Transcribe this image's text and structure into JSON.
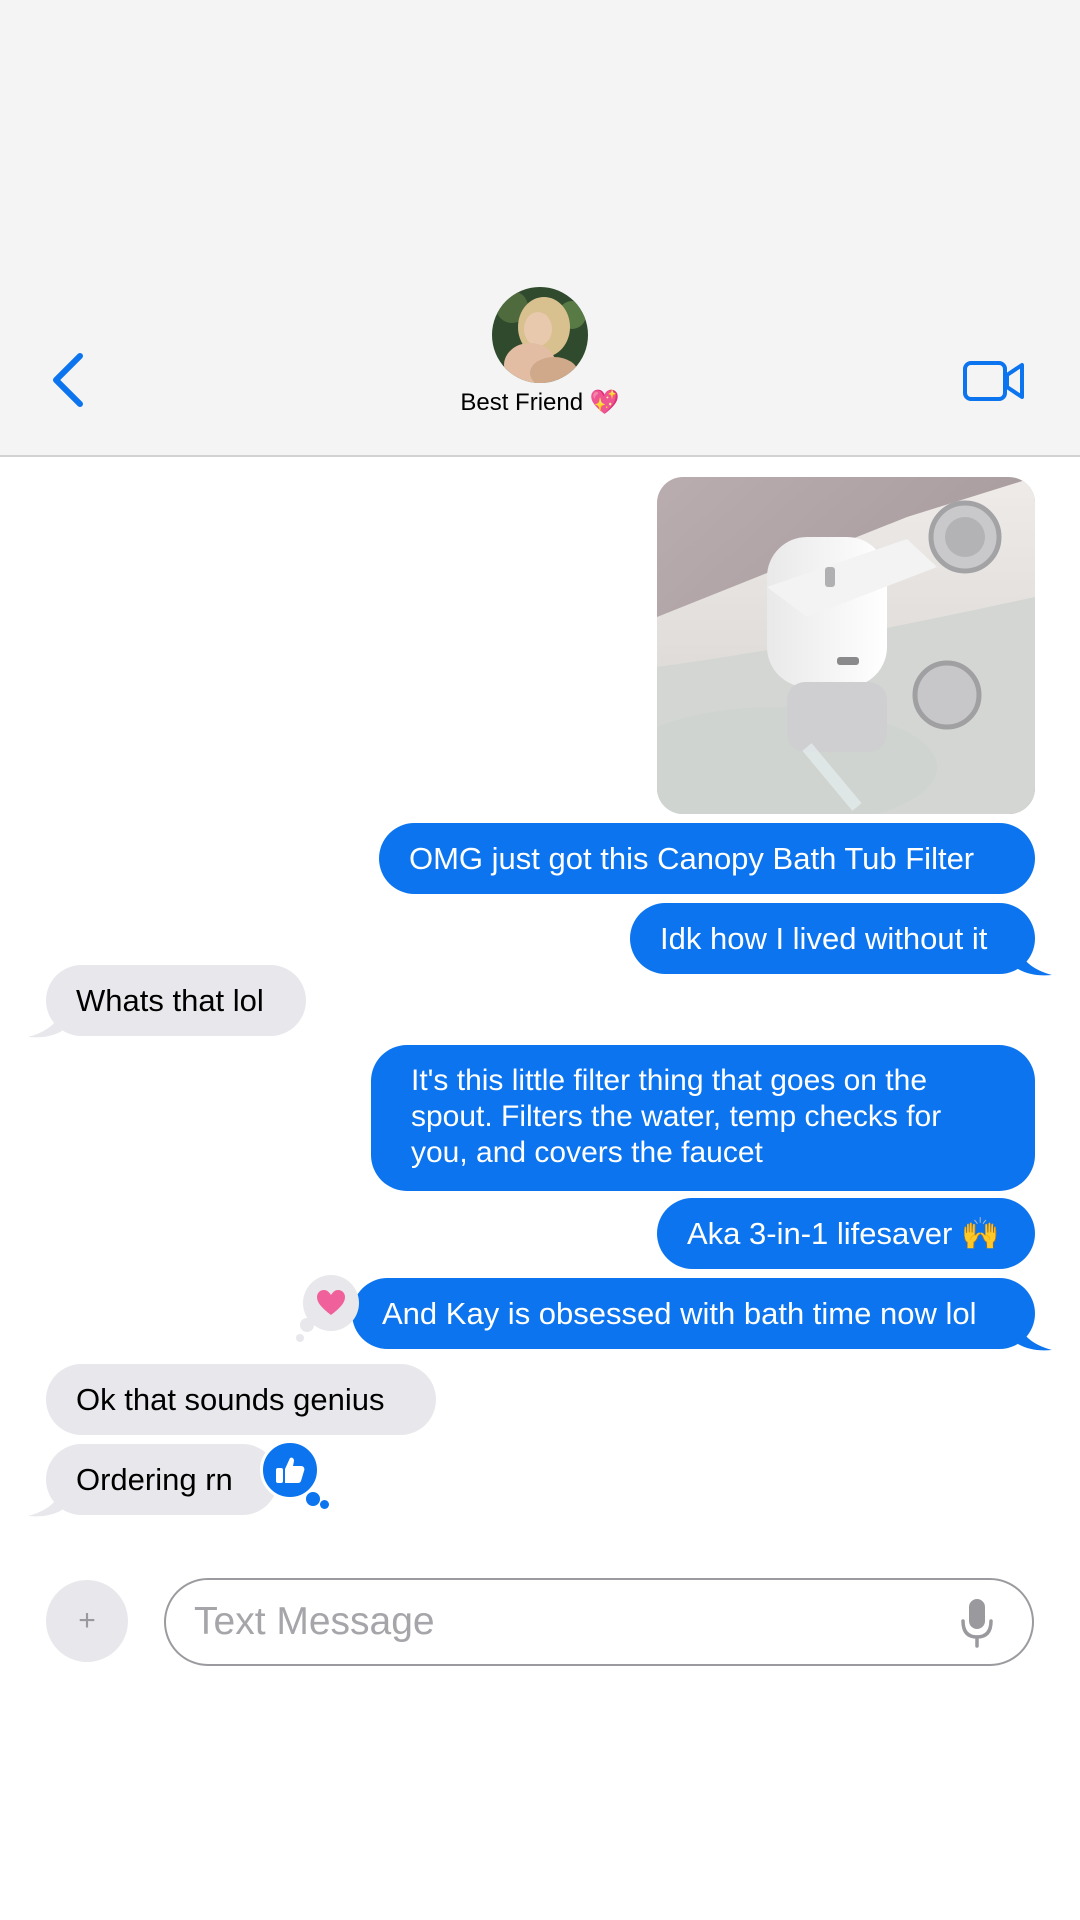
{
  "header": {
    "contact_name": "Best Friend 💖",
    "back_icon": "chevron-left-icon",
    "video_icon": "video-camera-icon"
  },
  "messages": [
    {
      "side": "outgoing",
      "type": "image",
      "alt_icon": "bath-faucet-filter-photo"
    },
    {
      "side": "outgoing",
      "text": "OMG just got this Canopy Bath Tub Filter"
    },
    {
      "side": "outgoing",
      "text": "Idk how I lived without it"
    },
    {
      "side": "incoming",
      "text": "Whats that lol"
    },
    {
      "side": "outgoing",
      "text": "It's this little filter thing that goes on the spout. Filters the water, temp checks for you, and covers the faucet"
    },
    {
      "side": "outgoing",
      "text": "Aka 3-in-1 lifesaver 🙌"
    },
    {
      "side": "outgoing",
      "text": "And Kay is obsessed with bath time now lol",
      "reaction": "heart-icon"
    },
    {
      "side": "incoming",
      "text": "Ok that sounds genius"
    },
    {
      "side": "incoming",
      "text": "Ordering rn",
      "reaction": "thumbs-up-icon"
    }
  ],
  "composer": {
    "plus_label": "+",
    "placeholder": "Text Message",
    "mic_icon": "microphone-icon"
  },
  "colors": {
    "accent": "#0b74ee",
    "incoming_bubble": "#e8e8ec",
    "header_bg": "#f4f4f4",
    "heart": "#f0609a"
  }
}
